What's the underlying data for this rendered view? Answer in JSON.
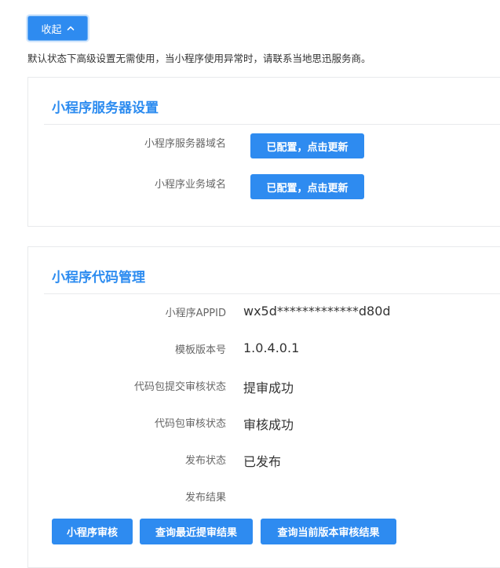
{
  "collapse_button": {
    "label": "收起"
  },
  "notice": "默认状态下高级设置无需使用，当小程序使用异常时，请联系当地思迅服务商。",
  "server_panel": {
    "title": "小程序服务器设置",
    "rows": [
      {
        "label": "小程序服务器域名",
        "button": "已配置，点击更新"
      },
      {
        "label": "小程序业务域名",
        "button": "已配置，点击更新"
      }
    ]
  },
  "code_panel": {
    "title": "小程序代码管理",
    "rows": [
      {
        "label": "小程序APPID",
        "value": "wx5d*************d80d"
      },
      {
        "label": "模板版本号",
        "value": "1.0.4.0.1"
      },
      {
        "label": "代码包提交审核状态",
        "value": "提审成功"
      },
      {
        "label": "代码包审核状态",
        "value": "审核成功"
      },
      {
        "label": "发布状态",
        "value": "已发布"
      },
      {
        "label": "发布结果",
        "value": ""
      }
    ],
    "buttons": {
      "audit": "小程序审核",
      "query_latest": "查询最近提审结果",
      "query_current": "查询当前版本审核结果"
    }
  },
  "colors": {
    "primary": "#2e8bf0",
    "title": "#2d8cf0",
    "border": "#e8eaec"
  }
}
